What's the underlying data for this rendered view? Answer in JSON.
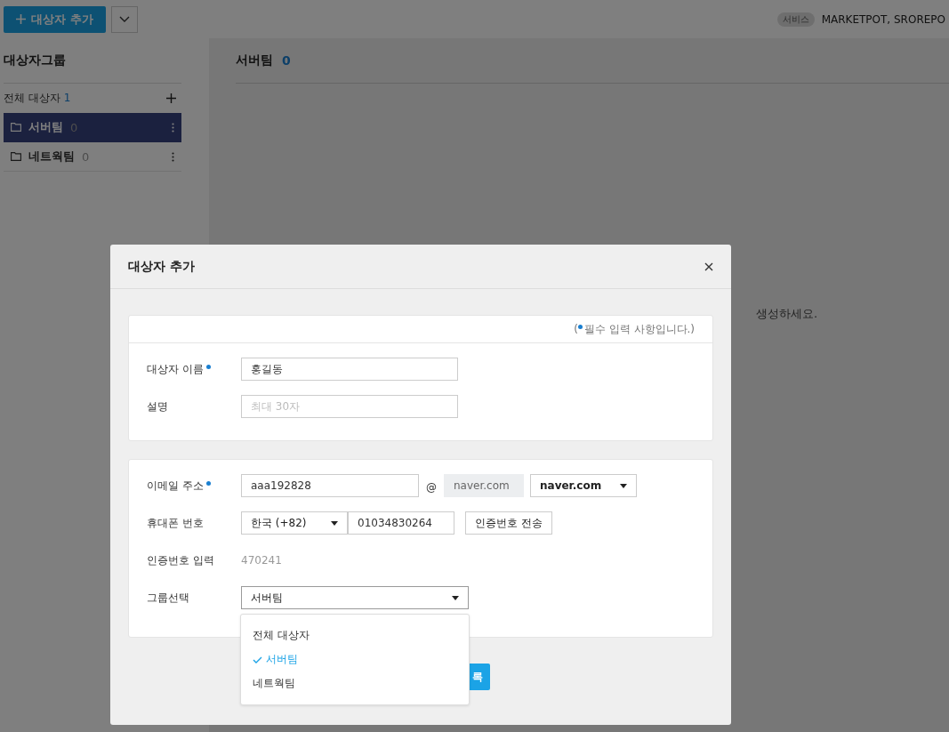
{
  "top_bar": {
    "add_button": "대상자 추가",
    "service_badge": "서비스",
    "service_names": "MARKETPOT, SROREPO"
  },
  "sidebar": {
    "title": "대상자그룹",
    "all": {
      "label": "전체 대상자",
      "count": "1"
    },
    "groups": [
      {
        "name": "서버팀",
        "count": "0",
        "selected": true
      },
      {
        "name": "네트웍팀",
        "count": "0",
        "selected": false
      }
    ]
  },
  "main": {
    "title": "서버팀",
    "count": "0",
    "empty_message": "생성하세요."
  },
  "dialog": {
    "title": "대상자 추가",
    "required_note": [
      "(",
      "필수 입력 사항입니다.)"
    ],
    "sections": [
      {
        "fields": [
          {
            "kind": "text",
            "label": "대상자 이름",
            "required": true,
            "value": "홍길동"
          },
          {
            "kind": "text",
            "label": "설명",
            "required": false,
            "placeholder": "최대 30자"
          }
        ]
      },
      {
        "fields": [
          {
            "kind": "email",
            "label": "이메일 주소",
            "required": true,
            "local": "aaa192828",
            "at": "@",
            "domain": "naver.com",
            "domain_select": "naver.com"
          },
          {
            "kind": "phone",
            "label": "휴대폰 번호",
            "required": false,
            "country": "한국 (+82)",
            "number": "01034830264",
            "button": "인증번호 전송"
          },
          {
            "kind": "code",
            "label": "인증번호 입력",
            "required": false,
            "value": "470241"
          },
          {
            "kind": "select",
            "label": "그룹선택",
            "required": false,
            "value": "서버팀",
            "expanded": true,
            "options": [
              {
                "label": "전체 대상자",
                "selected": false
              },
              {
                "label": "서버팀",
                "selected": true
              },
              {
                "label": "네트웍팀",
                "selected": false
              }
            ]
          }
        ]
      }
    ],
    "submit_button": "록"
  }
}
